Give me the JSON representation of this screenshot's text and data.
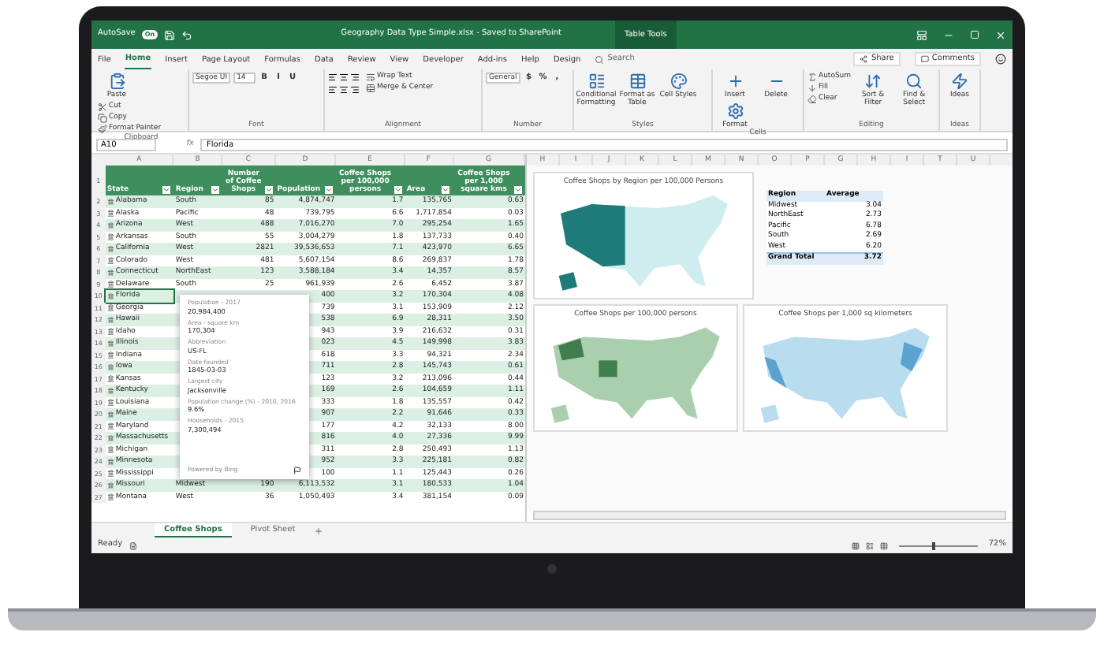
{
  "title_bar": {
    "autosave_label": "AutoSave",
    "autosave_state": "On",
    "autosave_on": true,
    "title": "Geography Data Type Simple.xlsx - Saved to SharePoint",
    "context_tab": "Table Tools"
  },
  "menu_tabs": [
    {
      "label": "File",
      "selected": false
    },
    {
      "label": "Home",
      "selected": true
    },
    {
      "label": "Insert",
      "selected": false
    },
    {
      "label": "Page Layout",
      "selected": false
    },
    {
      "label": "Formulas",
      "selected": false
    },
    {
      "label": "Data",
      "selected": false
    },
    {
      "label": "Review",
      "selected": false
    },
    {
      "label": "View",
      "selected": false
    },
    {
      "label": "Developer",
      "selected": false
    },
    {
      "label": "Add-ins",
      "selected": false
    },
    {
      "label": "Help",
      "selected": false
    },
    {
      "label": "Design",
      "selected": false
    }
  ],
  "search": {
    "placeholder": "Search"
  },
  "share": "Share",
  "comments": "Comments",
  "ribbon_groups": [
    {
      "name": "Clipboard",
      "items": [
        {
          "kind": "large",
          "label": "Paste"
        },
        {
          "kind": "small",
          "label": "Cut"
        },
        {
          "kind": "small",
          "label": "Copy"
        },
        {
          "kind": "small",
          "label": "Format Painter"
        }
      ]
    },
    {
      "name": "Font",
      "items": [
        {
          "kind": "field",
          "label": "Segoe UI"
        },
        {
          "kind": "field",
          "label": "14"
        },
        {
          "kind": "glyph",
          "label": "B"
        },
        {
          "kind": "glyph",
          "label": "I"
        },
        {
          "kind": "glyph",
          "label": "U"
        }
      ]
    },
    {
      "name": "Alignment",
      "items": [
        {
          "kind": "align"
        },
        {
          "kind": "small",
          "label": "Wrap Text"
        },
        {
          "kind": "small",
          "label": "Merge & Center"
        }
      ]
    },
    {
      "name": "Number",
      "items": [
        {
          "kind": "field",
          "label": "General"
        },
        {
          "kind": "glyph",
          "label": "$"
        },
        {
          "kind": "glyph",
          "label": "%"
        },
        {
          "kind": "glyph",
          "label": ","
        }
      ]
    },
    {
      "name": "Styles",
      "items": [
        {
          "kind": "large",
          "label": "Conditional Formatting"
        },
        {
          "kind": "large",
          "label": "Format as Table"
        },
        {
          "kind": "large",
          "label": "Cell Styles"
        }
      ]
    },
    {
      "name": "Cells",
      "items": [
        {
          "kind": "large",
          "label": "Insert"
        },
        {
          "kind": "large",
          "label": "Delete"
        },
        {
          "kind": "large",
          "label": "Format"
        }
      ]
    },
    {
      "name": "Editing",
      "items": [
        {
          "kind": "small",
          "label": "AutoSum"
        },
        {
          "kind": "small",
          "label": "Fill"
        },
        {
          "kind": "small",
          "label": "Clear"
        },
        {
          "kind": "large",
          "label": "Sort & Filter"
        },
        {
          "kind": "large",
          "label": "Find & Select"
        }
      ]
    },
    {
      "name": "Ideas",
      "items": [
        {
          "kind": "large",
          "label": "Ideas"
        }
      ]
    }
  ],
  "formula_bar": {
    "name_box": "A10",
    "fx_label": "fx",
    "formula": "Florida"
  },
  "left_columns": [
    "A",
    "B",
    "C",
    "D",
    "E",
    "F",
    "G"
  ],
  "right_columns": [
    "H",
    "I",
    "J",
    "K",
    "L",
    "M",
    "N",
    "O",
    "P",
    "G",
    "H",
    "I",
    "T",
    "U"
  ],
  "table": {
    "header_row": "1",
    "columns": [
      "State",
      "Region",
      "Number of Coffee Shops",
      "Population",
      "Coffee Shops per 100,000 persons",
      "Area",
      "Coffee Shops per 1,000 square kms"
    ],
    "rows": [
      {
        "row": "2",
        "selected": false,
        "cells": [
          "Alabama",
          "South",
          "85",
          "4,874,747",
          "1.7",
          "135,765",
          "0.63"
        ]
      },
      {
        "row": "3",
        "selected": false,
        "cells": [
          "Alaska",
          "Pacific",
          "48",
          "739,795",
          "6.6",
          "1,717,854",
          "0.03"
        ]
      },
      {
        "row": "4",
        "selected": false,
        "cells": [
          "Arizona",
          "West",
          "488",
          "7,016,270",
          "7.0",
          "295,254",
          "1.65"
        ]
      },
      {
        "row": "5",
        "selected": false,
        "cells": [
          "Arkansas",
          "South",
          "55",
          "3,004,279",
          "1.8",
          "137,733",
          "0.40"
        ]
      },
      {
        "row": "6",
        "selected": false,
        "cells": [
          "California",
          "West",
          "2821",
          "39,536,653",
          "7.1",
          "423,970",
          "6.65"
        ]
      },
      {
        "row": "7",
        "selected": false,
        "cells": [
          "Colorado",
          "West",
          "481",
          "5,607,154",
          "8.6",
          "269,837",
          "1.78"
        ]
      },
      {
        "row": "8",
        "selected": false,
        "cells": [
          "Connecticut",
          "NorthEast",
          "123",
          "3,588,184",
          "3.4",
          "14,357",
          "8.57"
        ]
      },
      {
        "row": "9",
        "selected": false,
        "cells": [
          "Delaware",
          "South",
          "25",
          "961,939",
          "2.6",
          "6,452",
          "3.87"
        ]
      },
      {
        "row": "10",
        "selected": true,
        "cells": [
          "Florida",
          null,
          null,
          "400",
          "3.2",
          "170,304",
          "4.08"
        ]
      },
      {
        "row": "11",
        "selected": false,
        "cells": [
          "Georgia",
          null,
          null,
          "739",
          "3.1",
          "153,909",
          "2.12"
        ]
      },
      {
        "row": "12",
        "selected": false,
        "cells": [
          "Hawaii",
          null,
          null,
          "538",
          "6.9",
          "28,311",
          "3.50"
        ]
      },
      {
        "row": "13",
        "selected": false,
        "cells": [
          "Idaho",
          null,
          null,
          "943",
          "3.9",
          "216,632",
          "0.31"
        ]
      },
      {
        "row": "14",
        "selected": false,
        "cells": [
          "Illinois",
          null,
          null,
          "023",
          "4.5",
          "149,998",
          "3.83"
        ]
      },
      {
        "row": "15",
        "selected": false,
        "cells": [
          "Indiana",
          null,
          null,
          "618",
          "3.3",
          "94,321",
          "2.34"
        ]
      },
      {
        "row": "16",
        "selected": false,
        "cells": [
          "Iowa",
          null,
          null,
          "711",
          "2.8",
          "145,743",
          "0.61"
        ]
      },
      {
        "row": "17",
        "selected": false,
        "cells": [
          "Kansas",
          null,
          null,
          "123",
          "3.2",
          "213,096",
          "0.44"
        ]
      },
      {
        "row": "18",
        "selected": false,
        "cells": [
          "Kentucky",
          null,
          null,
          "169",
          "2.6",
          "104,659",
          "1.11"
        ]
      },
      {
        "row": "19",
        "selected": false,
        "cells": [
          "Louisiana",
          null,
          null,
          "333",
          "1.8",
          "135,557",
          "0.42"
        ]
      },
      {
        "row": "20",
        "selected": false,
        "cells": [
          "Maine",
          null,
          null,
          "907",
          "2.2",
          "91,646",
          "0.33"
        ]
      },
      {
        "row": "21",
        "selected": false,
        "cells": [
          "Maryland",
          null,
          null,
          "177",
          "4.2",
          "32,133",
          "8.00"
        ]
      },
      {
        "row": "22",
        "selected": false,
        "cells": [
          "Massachusetts",
          null,
          null,
          "816",
          "4.0",
          "27,336",
          "9.99"
        ]
      },
      {
        "row": "23",
        "selected": false,
        "cells": [
          "Michigan",
          null,
          null,
          "311",
          "2.8",
          "250,493",
          "1.13"
        ]
      },
      {
        "row": "24",
        "selected": false,
        "cells": [
          "Minnesota",
          null,
          null,
          "952",
          "3.3",
          "225,181",
          "0.82"
        ]
      },
      {
        "row": "25",
        "selected": false,
        "cells": [
          "Mississippi",
          null,
          null,
          "100",
          "1.1",
          "125,443",
          "0.26"
        ]
      },
      {
        "row": "26",
        "selected": false,
        "cells": [
          "Missouri",
          "Midwest",
          "190",
          "6,113,532",
          "3.1",
          "180,533",
          "1.04"
        ]
      },
      {
        "row": "27",
        "selected": false,
        "cells": [
          "Montana",
          "West",
          "36",
          "1,050,493",
          "3.4",
          "381,154",
          "0.09"
        ]
      }
    ]
  },
  "data_card": {
    "fields": [
      {
        "label": "Population - 2017",
        "value": "20,984,400"
      },
      {
        "label": "Area - square km",
        "value": "170,304"
      },
      {
        "label": "Abbreviation",
        "value": "US-FL"
      },
      {
        "label": "Date founded",
        "value": "1845-03-03"
      },
      {
        "label": "Largest city",
        "value": "Jacksonville"
      },
      {
        "label": "Population change (%) - 2010, 2016",
        "value": "9.6%"
      },
      {
        "label": "Households - 2015",
        "value": "7,300,494"
      }
    ],
    "footer": "Powered by Bing"
  },
  "maps": [
    {
      "title": "Coffee Shops by Region per 100,000 Persons",
      "kind": "region"
    },
    {
      "title": "Coffee Shops per 100,000 persons",
      "kind": "green"
    },
    {
      "title": "Coffee Shops per 1,000 sq kilometers",
      "kind": "blue"
    }
  ],
  "pivot": {
    "columns": [
      "Region",
      "Average"
    ],
    "rows": [
      {
        "kind": "row",
        "label": "Midwest",
        "value": "3.04"
      },
      {
        "kind": "row",
        "label": "NorthEast",
        "value": "2.73"
      },
      {
        "kind": "row",
        "label": "Pacific",
        "value": "6.78"
      },
      {
        "kind": "row",
        "label": "South",
        "value": "2.69"
      },
      {
        "kind": "row",
        "label": "West",
        "value": "6.20"
      },
      {
        "kind": "total",
        "label": "Grand Total",
        "value": "3.72"
      }
    ]
  },
  "sheet_tabs": [
    {
      "label": "Coffee Shops",
      "selected": true
    },
    {
      "label": "Pivot Sheet",
      "selected": false
    }
  ],
  "status_bar": {
    "status": "Ready",
    "zoom": {
      "level": 0.45,
      "reading": "72%"
    }
  }
}
